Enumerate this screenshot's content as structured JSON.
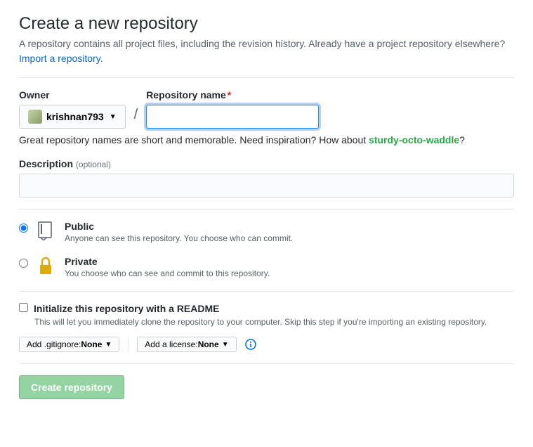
{
  "header": {
    "title": "Create a new repository",
    "subtitle": "A repository contains all project files, including the revision history. Already have a project repository elsewhere?",
    "importLink": "Import a repository"
  },
  "owner": {
    "label": "Owner",
    "username": "krishnan793"
  },
  "repoName": {
    "label": "Repository name",
    "value": ""
  },
  "hint": {
    "prefix": "Great repository names are short and memorable. Need inspiration? How about ",
    "suggestion": "sturdy-octo-waddle",
    "suffix": "?"
  },
  "description": {
    "label": "Description",
    "optional": "(optional)",
    "value": ""
  },
  "visibility": {
    "public": {
      "title": "Public",
      "desc": "Anyone can see this repository. You choose who can commit."
    },
    "private": {
      "title": "Private",
      "desc": "You choose who can see and commit to this repository."
    },
    "selected": "public"
  },
  "readme": {
    "title": "Initialize this repository with a README",
    "desc": "This will let you immediately clone the repository to your computer. Skip this step if you're importing an existing repository."
  },
  "gitignore": {
    "prefix": "Add .gitignore: ",
    "value": "None"
  },
  "license": {
    "prefix": "Add a license: ",
    "value": "None"
  },
  "createButton": "Create repository"
}
